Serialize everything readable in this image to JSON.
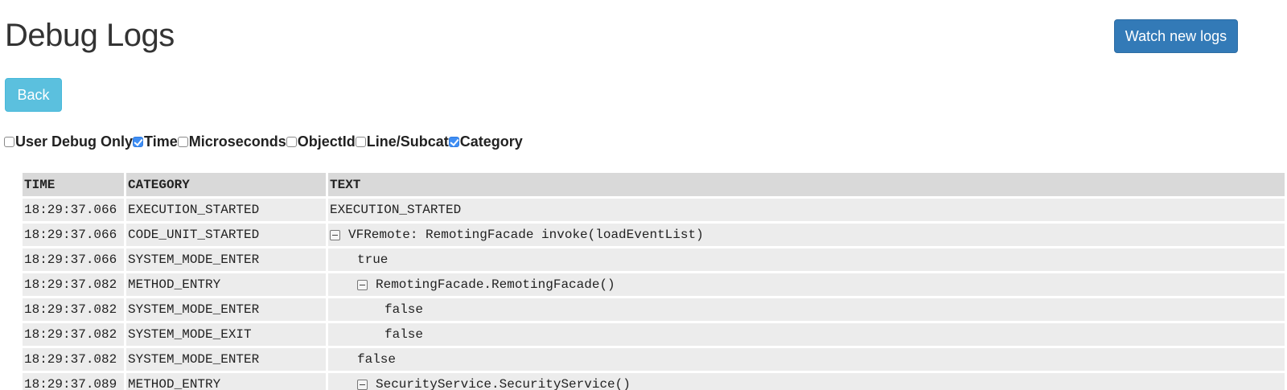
{
  "header": {
    "title": "Debug Logs",
    "watch_button": "Watch new logs",
    "back_button": "Back"
  },
  "filters": [
    {
      "label": "User Debug Only",
      "checked": false
    },
    {
      "label": "Time",
      "checked": true
    },
    {
      "label": "Microseconds",
      "checked": false
    },
    {
      "label": "ObjectId",
      "checked": false
    },
    {
      "label": "Line/Subcat",
      "checked": false
    },
    {
      "label": "Category",
      "checked": true
    }
  ],
  "table": {
    "columns": [
      "TIME",
      "CATEGORY",
      "TEXT"
    ],
    "rows": [
      {
        "time": "18:29:37.066",
        "category": "EXECUTION_STARTED",
        "text": "EXECUTION_STARTED",
        "depth": 0,
        "collapsible": false
      },
      {
        "time": "18:29:37.066",
        "category": "CODE_UNIT_STARTED",
        "text": "VFRemote: RemotingFacade invoke(loadEventList)",
        "depth": 0,
        "collapsible": true
      },
      {
        "time": "18:29:37.066",
        "category": "SYSTEM_MODE_ENTER",
        "text": "true",
        "depth": 1,
        "collapsible": false
      },
      {
        "time": "18:29:37.082",
        "category": "METHOD_ENTRY",
        "text": "RemotingFacade.RemotingFacade()",
        "depth": 1,
        "collapsible": true
      },
      {
        "time": "18:29:37.082",
        "category": "SYSTEM_MODE_ENTER",
        "text": "false",
        "depth": 2,
        "collapsible": false
      },
      {
        "time": "18:29:37.082",
        "category": "SYSTEM_MODE_EXIT",
        "text": "false",
        "depth": 2,
        "collapsible": false
      },
      {
        "time": "18:29:37.082",
        "category": "SYSTEM_MODE_ENTER",
        "text": "false",
        "depth": 1,
        "collapsible": false
      },
      {
        "time": "18:29:37.089",
        "category": "METHOD_ENTRY",
        "text": "SecurityService.SecurityService()",
        "depth": 1,
        "collapsible": true
      }
    ]
  }
}
